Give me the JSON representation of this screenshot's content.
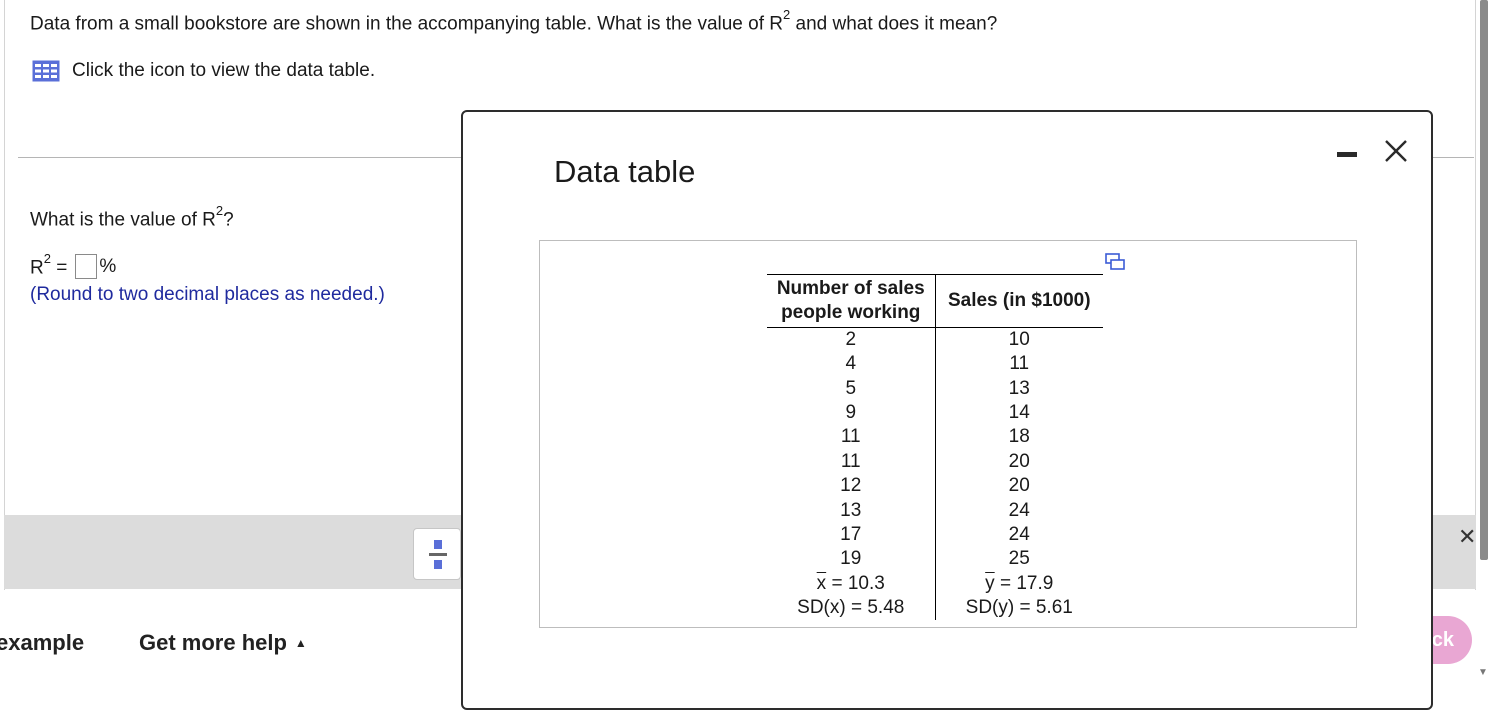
{
  "question": {
    "text_pre": "Data from a small bookstore are shown in the accompanying table. What is the value of R",
    "text_sup": "2",
    "text_post": " and what does it mean?",
    "table_link": "Click the icon to view the data table."
  },
  "part": {
    "prompt_pre": "What is the value of R",
    "prompt_sup": "2",
    "prompt_post": "?",
    "answer_label": "R",
    "answer_sup": "2",
    "answer_eq": " =",
    "answer_value": "",
    "answer_unit": "%",
    "hint": "(Round to two decimal places as needed.)"
  },
  "footer": {
    "example": "example",
    "help": "Get more help",
    "help_caret": "▲",
    "check": "ck"
  },
  "modal": {
    "title": "Data table",
    "headers": [
      "Number of sales people working",
      "Sales (in $1000)"
    ],
    "header1_line1": "Number of sales",
    "header1_line2": "people working",
    "rows": [
      [
        "2",
        "10"
      ],
      [
        "4",
        "11"
      ],
      [
        "5",
        "13"
      ],
      [
        "9",
        "14"
      ],
      [
        "11",
        "18"
      ],
      [
        "11",
        "20"
      ],
      [
        "12",
        "20"
      ],
      [
        "13",
        "24"
      ],
      [
        "17",
        "24"
      ],
      [
        "19",
        "25"
      ]
    ],
    "summary": {
      "x_symbol": "x",
      "mean_x": " = 10.3",
      "y_symbol": "y",
      "mean_y": " = 17.9",
      "sd_x": "SD(x) = 5.48",
      "sd_y": "SD(y) = 5.61"
    }
  },
  "colors": {
    "hint": "#1f2a9e",
    "icon_blue": "#5a6fd8",
    "check_button": "#e9a7d3",
    "tool_strip": "#dcdcdc"
  },
  "icons": [
    "grid-table-icon",
    "fraction-icon",
    "minimize-icon",
    "close-icon",
    "copy-icon"
  ]
}
